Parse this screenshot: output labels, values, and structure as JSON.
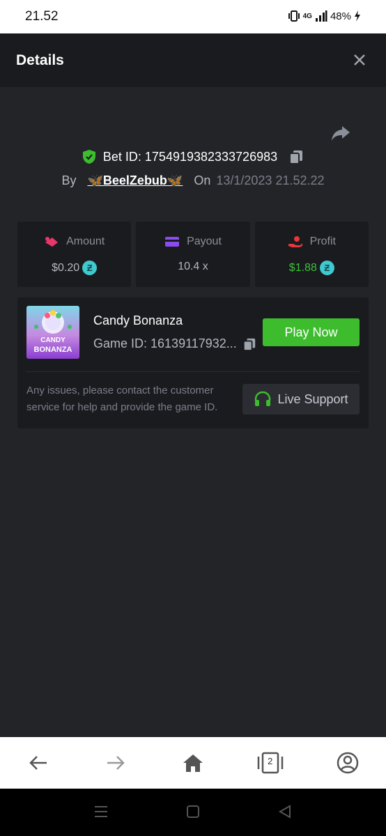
{
  "status_bar": {
    "time": "21.52",
    "network": "4G",
    "battery": "48%"
  },
  "header": {
    "title": "Details"
  },
  "bet": {
    "id_label": "Bet ID:",
    "id_value": "1754919382333726983",
    "by_label": "By",
    "username": "🦋BeelZebub🦋",
    "on_label": "On",
    "date": "13/1/2023 21.52.22"
  },
  "stats": {
    "amount": {
      "label": "Amount",
      "value": "$0.20"
    },
    "payout": {
      "label": "Payout",
      "value": "10.4 x"
    },
    "profit": {
      "label": "Profit",
      "value": "$1.88"
    }
  },
  "game": {
    "thumb_text_1": "CANDY",
    "thumb_text_2": "BONANZA",
    "name": "Candy Bonanza",
    "game_id": "Game ID: 16139117932...",
    "play_label": "Play Now",
    "issue_text": "Any issues, please contact the customer service for help and provide the game ID.",
    "support_label": "Live Support"
  },
  "browser_nav": {
    "tabs_count": "2"
  },
  "colors": {
    "accent_green": "#3dbd2d",
    "coin": "#3fcad0",
    "bg": "#232428",
    "panel": "#1a1b1e"
  }
}
